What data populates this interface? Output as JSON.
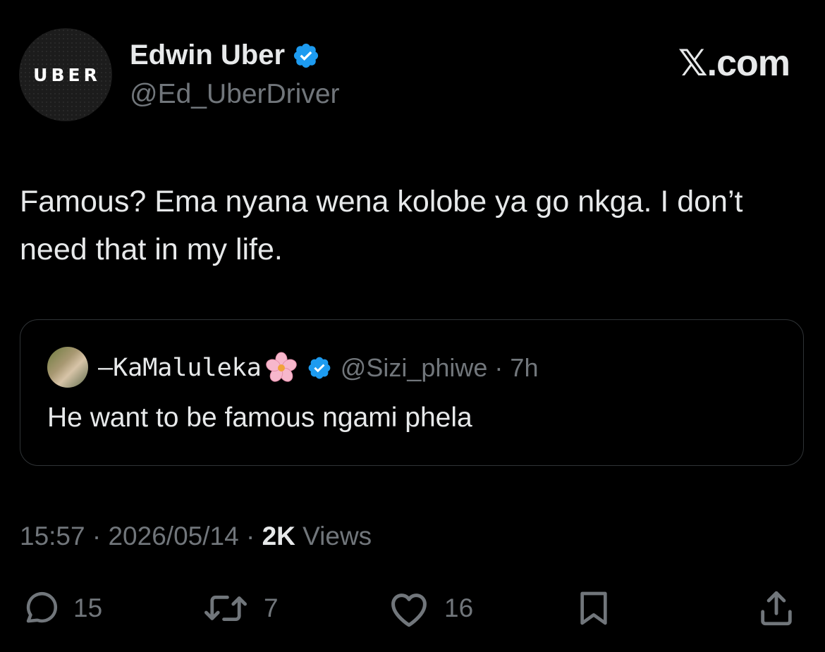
{
  "author": {
    "avatar_text": "UBER",
    "display_name": "Edwin Uber",
    "handle": "@Ed_UberDriver",
    "verified_icon": "verified-badge-icon"
  },
  "brand": "𝕏.com",
  "tweet": {
    "text": "Famous? Ema nyana wena kolobe ya go nkga. I don’t need that in my life."
  },
  "quoted_tweet": {
    "display_name": "—KaMaluleka",
    "emoji": "cherry-blossom-icon",
    "handle_time": "@Sizi_phiwe · 7h",
    "text": "He want to be famous ngami phela"
  },
  "meta": {
    "time": "15:57",
    "date": "2026/05/14",
    "views_count": "2K",
    "views_label": "Views"
  },
  "actions": {
    "reply_count": "15",
    "retweet_count": "7",
    "like_count": "16"
  },
  "colors": {
    "background": "#000000",
    "text": "#e7e9ea",
    "muted": "#71767b",
    "verified": "#1d9bf0",
    "border": "#2f3336"
  }
}
